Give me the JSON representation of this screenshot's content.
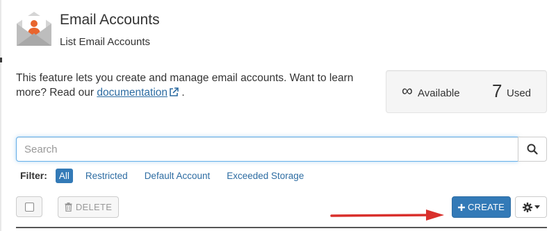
{
  "header": {
    "title": "Email Accounts",
    "subtitle": "List Email Accounts",
    "icon": "email-account-icon"
  },
  "description": {
    "text_before": "This feature lets you create and manage email accounts. Want to learn more? Read our",
    "link_label": "documentation",
    "text_after": ".",
    "link_icon": "external-link-icon"
  },
  "stats": {
    "available_value": "∞",
    "available_label": "Available",
    "used_value": "7",
    "used_label": "Used"
  },
  "search": {
    "placeholder": "Search",
    "value": "",
    "button_icon": "search-icon"
  },
  "filter": {
    "label": "Filter:",
    "options": [
      "All",
      "Restricted",
      "Default Account",
      "Exceeded Storage"
    ],
    "selected": "All"
  },
  "toolbar": {
    "delete_label": "DELETE",
    "create_label": "CREATE",
    "create_icon": "plus-icon",
    "delete_icon": "trash-icon",
    "settings_icon": "gear-icon"
  },
  "colors": {
    "primary": "#337ab7",
    "link": "#2d6ca2",
    "annotation_arrow": "#d9302c",
    "icon_orange": "#e8652e"
  }
}
